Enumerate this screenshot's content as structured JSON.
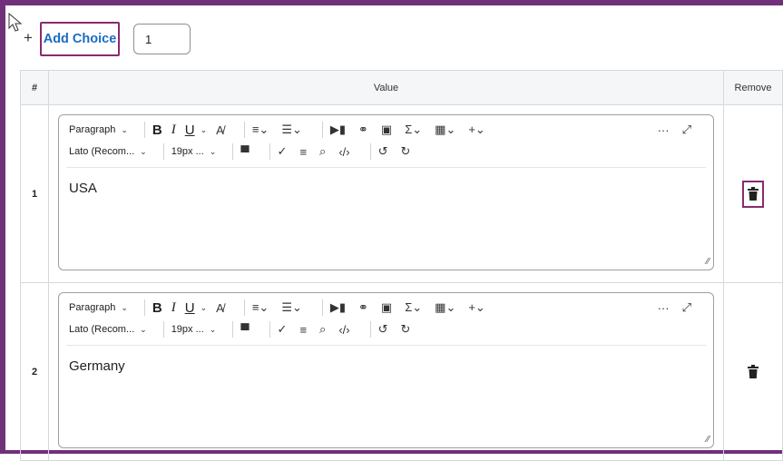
{
  "header": {
    "add_plus": "+",
    "add_choice_label": "Add Choice",
    "count_value": "1"
  },
  "table": {
    "columns": [
      "#",
      "Value",
      "Remove"
    ]
  },
  "toolbar": {
    "paragraph": "Paragraph",
    "font": "Lato (Recom...",
    "size": "19px ...",
    "bold": "B",
    "italic": "I",
    "underline": "U",
    "more": "···"
  },
  "rows": [
    {
      "num": "1",
      "value": "USA",
      "remove_highlighted": true
    },
    {
      "num": "2",
      "value": "Germany",
      "remove_highlighted": false
    }
  ],
  "colors": {
    "accent_frame": "#70307a",
    "highlight": "#8a2a6f",
    "link": "#1a6cc4"
  }
}
